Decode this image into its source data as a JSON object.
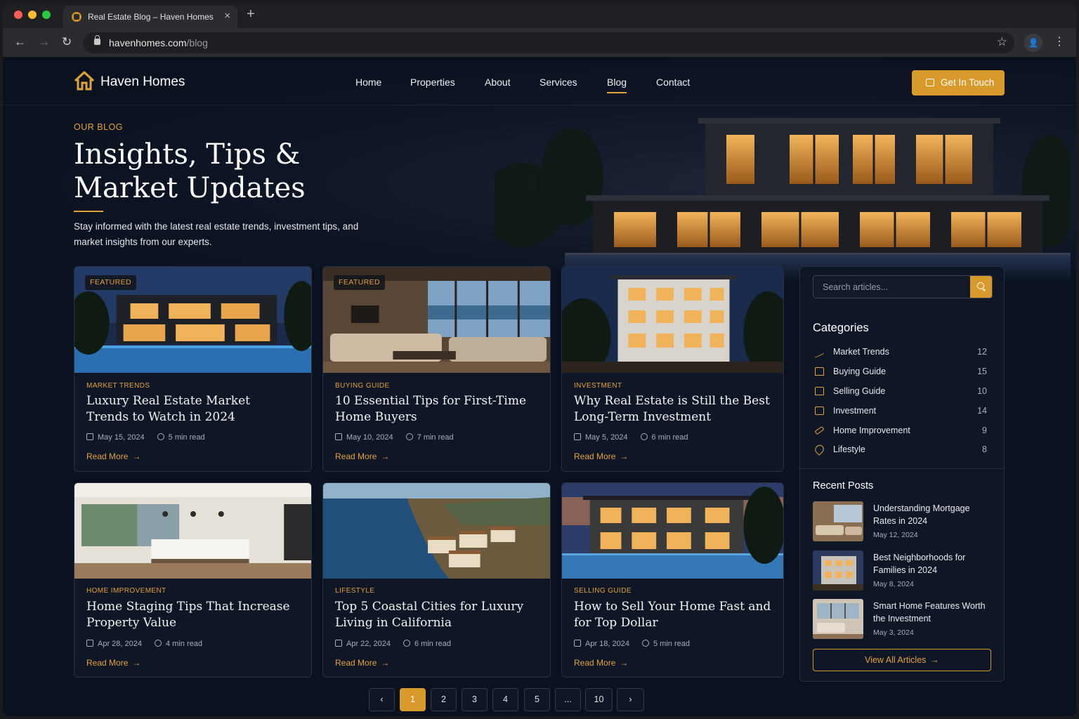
{
  "browser": {
    "tab_title": "Real Estate Blog – Haven Homes",
    "url_domain": "havenhomes.com",
    "url_path": "/blog"
  },
  "nav": {
    "brand": "Haven Homes",
    "links": [
      "Home",
      "Properties",
      "About",
      "Services",
      "Blog",
      "Contact"
    ],
    "active": "Blog",
    "cta_label": "Get In Touch"
  },
  "hero": {
    "eyebrow": "OUR BLOG",
    "title": "Insights, Tips & Market Updates",
    "description": "Stay informed with the latest real estate trends, investment tips, and market insights from our experts."
  },
  "posts": [
    {
      "featured": "FEATURED",
      "category": "MARKET TRENDS",
      "title": "Luxury Real Estate Market Trends to Watch in 2024",
      "date": "May 15, 2024",
      "read_time": "5 min read",
      "cta": "Read More"
    },
    {
      "featured": "FEATURED",
      "category": "BUYING GUIDE",
      "title": "10 Essential Tips for First-Time Home Buyers",
      "date": "May 10, 2024",
      "read_time": "7 min read",
      "cta": "Read More"
    },
    {
      "featured": "",
      "category": "INVESTMENT",
      "title": "Why Real Estate is Still the Best Long-Term Investment",
      "date": "May 5, 2024",
      "read_time": "6 min read",
      "cta": "Read More"
    },
    {
      "featured": "",
      "category": "HOME IMPROVEMENT",
      "title": "Home Staging Tips That Increase Property Value",
      "date": "Apr 28, 2024",
      "read_time": "4 min read",
      "cta": "Read More"
    },
    {
      "featured": "",
      "category": "LIFESTYLE",
      "title": "Top 5 Coastal Cities for Luxury Living in California",
      "date": "Apr 22, 2024",
      "read_time": "6 min read",
      "cta": "Read More"
    },
    {
      "featured": "",
      "category": "SELLING GUIDE",
      "title": "How to Sell Your Home Fast and for Top Dollar",
      "date": "Apr 18, 2024",
      "read_time": "5 min read",
      "cta": "Read More"
    }
  ],
  "sidebar": {
    "search_placeholder": "Search articles...",
    "categories_heading": "Categories",
    "categories": [
      {
        "label": "Market Trends",
        "count": "12",
        "icon": "trend-icon"
      },
      {
        "label": "Buying Guide",
        "count": "15",
        "icon": "home-icon"
      },
      {
        "label": "Selling Guide",
        "count": "10",
        "icon": "home-icon"
      },
      {
        "label": "Investment",
        "count": "14",
        "icon": "chart-icon"
      },
      {
        "label": "Home Improvement",
        "count": "9",
        "icon": "hammer-icon"
      },
      {
        "label": "Lifestyle",
        "count": "8",
        "icon": "heart-icon"
      }
    ],
    "recent_heading": "Recent Posts",
    "recent": [
      {
        "title": "Understanding Mortgage Rates in 2024",
        "date": "May 12, 2024"
      },
      {
        "title": "Best Neighborhoods for Families in 2024",
        "date": "May 8, 2024"
      },
      {
        "title": "Smart Home Features Worth the Investment",
        "date": "May 3, 2024"
      }
    ],
    "view_all": "View All Articles"
  },
  "pagination": {
    "pages": [
      "1",
      "2",
      "3",
      "4",
      "5",
      "...",
      "10"
    ],
    "current": "1",
    "prev": "‹",
    "next": "›"
  },
  "colors": {
    "accent": "#d89a2b",
    "background": "#0a1220",
    "card": "#0f1727"
  }
}
